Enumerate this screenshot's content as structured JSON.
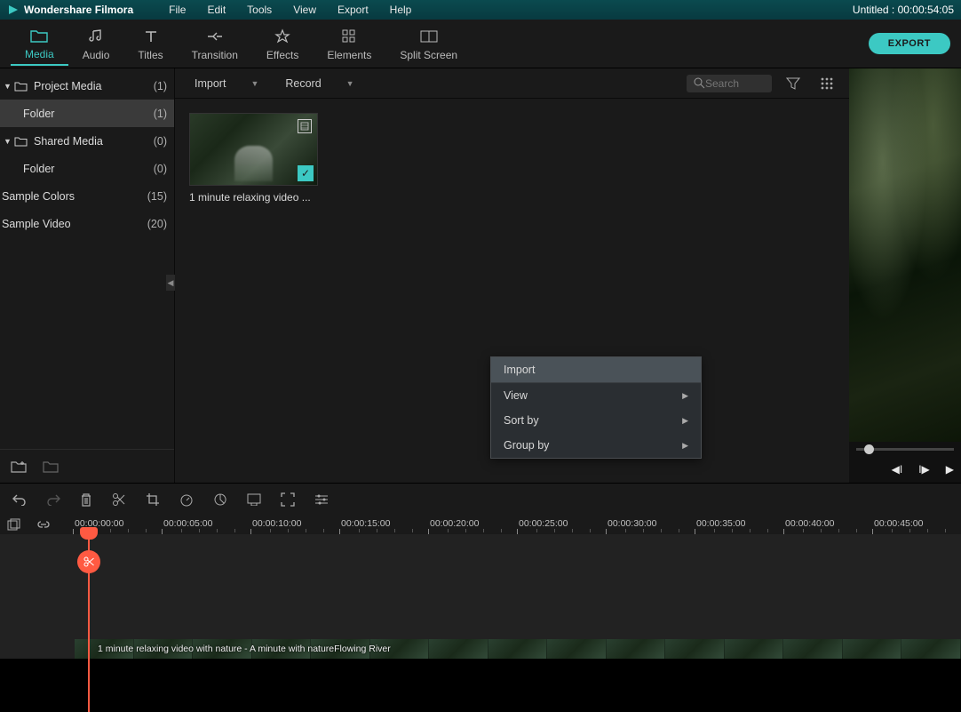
{
  "app": {
    "name": "Wondershare Filmora",
    "title_right": "Untitled : 00:00:54:05"
  },
  "menu": [
    "File",
    "Edit",
    "Tools",
    "View",
    "Export",
    "Help"
  ],
  "tabs": [
    {
      "id": "media",
      "label": "Media",
      "active": true
    },
    {
      "id": "audio",
      "label": "Audio"
    },
    {
      "id": "titles",
      "label": "Titles"
    },
    {
      "id": "transition",
      "label": "Transition"
    },
    {
      "id": "effects",
      "label": "Effects"
    },
    {
      "id": "elements",
      "label": "Elements"
    },
    {
      "id": "splitscreen",
      "label": "Split Screen"
    }
  ],
  "export_label": "EXPORT",
  "tree": [
    {
      "label": "Project Media",
      "count": "(1)",
      "expandable": true,
      "icon": true
    },
    {
      "label": "Folder",
      "count": "(1)",
      "child": true,
      "selected": true
    },
    {
      "label": "Shared Media",
      "count": "(0)",
      "expandable": true,
      "icon": true
    },
    {
      "label": "Folder",
      "count": "(0)",
      "child": true
    },
    {
      "label": "Sample Colors",
      "count": "(15)"
    },
    {
      "label": "Sample Video",
      "count": "(20)"
    }
  ],
  "dd_import": "Import",
  "dd_record": "Record",
  "search": {
    "placeholder": "Search"
  },
  "thumb": {
    "label": "1 minute relaxing video ..."
  },
  "ctx": [
    {
      "label": "Import",
      "hl": true
    },
    {
      "label": "View",
      "sub": true
    },
    {
      "label": "Sort by",
      "sub": true
    },
    {
      "label": "Group by",
      "sub": true
    }
  ],
  "ruler": [
    "00:00:00:00",
    "00:00:05:00",
    "00:00:10:00",
    "00:00:15:00",
    "00:00:20:00",
    "00:00:25:00",
    "00:00:30:00",
    "00:00:35:00",
    "00:00:40:00",
    "00:00:45:00"
  ],
  "clip": {
    "label": "1 minute relaxing video with nature - A minute with natureFlowing River"
  }
}
